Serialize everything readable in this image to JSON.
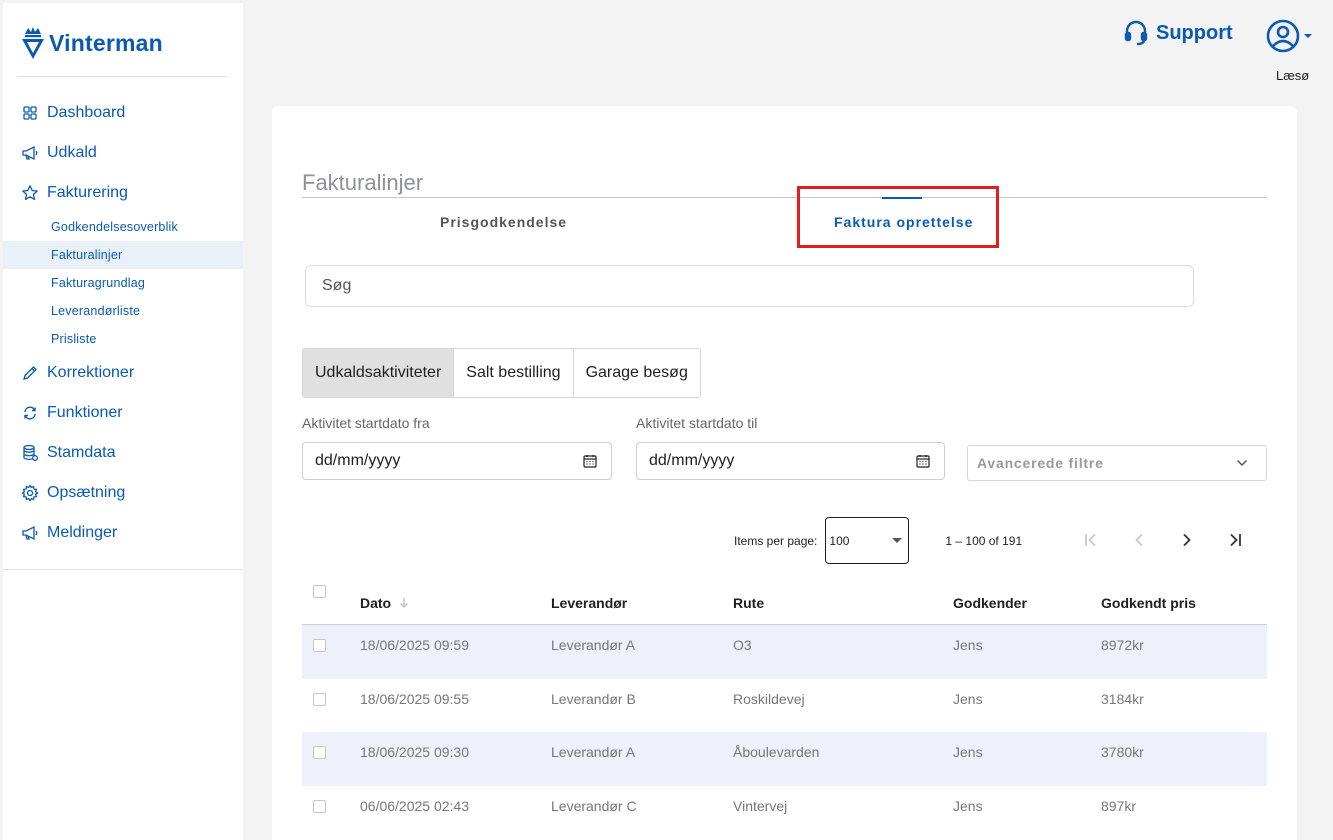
{
  "brand": {
    "name": "Vinterman",
    "color": "#0a5ab3"
  },
  "sidebar": {
    "items": [
      {
        "label": "Dashboard",
        "icon": "grid-icon"
      },
      {
        "label": "Udkald",
        "icon": "megaphone-icon"
      },
      {
        "label": "Fakturering",
        "icon": "star-icon"
      },
      {
        "label": "Korrektioner",
        "icon": "pencil-icon"
      },
      {
        "label": "Funktioner",
        "icon": "refresh-icon"
      },
      {
        "label": "Stamdata",
        "icon": "database-icon"
      },
      {
        "label": "Opsætning",
        "icon": "gear-icon"
      },
      {
        "label": "Meldinger",
        "icon": "megaphone-icon"
      }
    ],
    "subitems": [
      {
        "label": "Godkendelsesoverblik",
        "active": false
      },
      {
        "label": "Fakturalinjer",
        "active": true
      },
      {
        "label": "Fakturagrundlag",
        "active": false
      },
      {
        "label": "Leverandørliste",
        "active": false
      },
      {
        "label": "Prisliste",
        "active": false
      }
    ]
  },
  "header": {
    "support_label": "Support",
    "account_label": "Læsø"
  },
  "page": {
    "title": "Fakturalinjer",
    "tabs": [
      {
        "label": "Prisgodkendelse",
        "active": false
      },
      {
        "label": "Faktura oprettelse",
        "active": true
      }
    ],
    "search_placeholder": "Søg",
    "segments": [
      {
        "label": "Udkaldsaktiviteter",
        "active": true
      },
      {
        "label": "Salt bestilling",
        "active": false
      },
      {
        "label": "Garage besøg",
        "active": false
      }
    ],
    "filters": {
      "from_label": "Aktivitet startdato fra",
      "from_value": "dd/mm/yyyy",
      "to_label": "Aktivitet startdato til",
      "to_value": "dd/mm/yyyy",
      "advanced_label": "Avancerede filtre"
    },
    "paginator": {
      "items_per_page_label": "Items per page:",
      "items_per_page": "100",
      "range": "1 – 100 of 191"
    },
    "table": {
      "columns": [
        "Dato",
        "Leverandør",
        "Rute",
        "Godkender",
        "Godkendt pris"
      ],
      "rows": [
        [
          "18/06/2025 09:59",
          "Leverandør A",
          "O3",
          "Jens",
          "8972kr"
        ],
        [
          "18/06/2025 09:55",
          "Leverandør B",
          "Roskildevej",
          "Jens",
          "3184kr"
        ],
        [
          "18/06/2025 09:30",
          "Leverandør A",
          "Åboulevarden",
          "Jens",
          "3780kr"
        ],
        [
          "06/06/2025 02:43",
          "Leverandør C",
          "Vintervej",
          "Jens",
          "897kr"
        ]
      ]
    }
  },
  "colors": {
    "accent": "#0a5ab3",
    "highlight": "#e02020",
    "active_row": "#e9f0f8",
    "stripe": "#eef1f9"
  }
}
